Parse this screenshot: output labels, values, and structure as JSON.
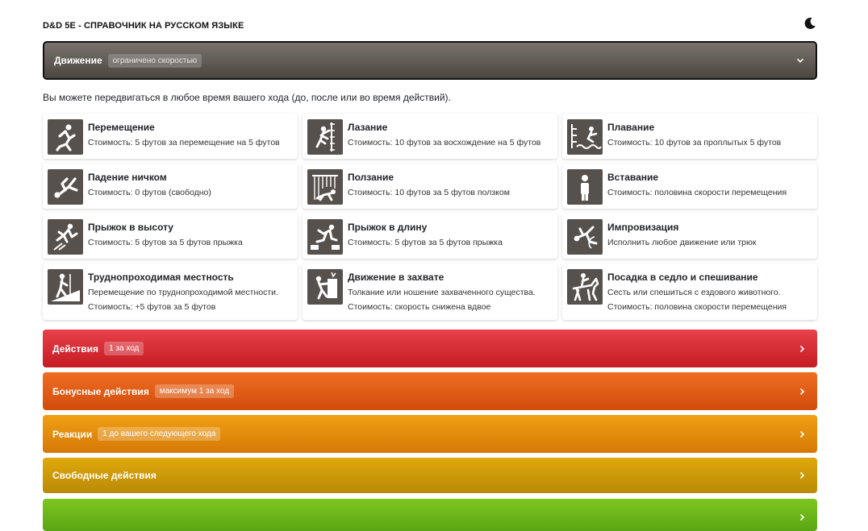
{
  "header": {
    "title": "D&D 5E - СПРАВОЧНИК НА РУССКОМ ЯЗЫКЕ",
    "theme_icon": "moon-icon"
  },
  "movement": {
    "title": "Движение",
    "badge": "ограничено скоростью",
    "intro": "Вы можете передвигаться в любое время вашего хода (до, после или во время действий).",
    "cards": [
      {
        "name": "Перемещение",
        "line1": "Стоимость: 5 футов за перемещение на 5 футов",
        "line2": "",
        "icon": "running-person-icon"
      },
      {
        "name": "Лазание",
        "line1": "Стоимость: 10 футов за восхождение на 5 футов",
        "line2": "",
        "icon": "climbing-icon"
      },
      {
        "name": "Плавание",
        "line1": "Стоимость: 10 футов за проплытых 5 футов",
        "line2": "",
        "icon": "diving-icon"
      },
      {
        "name": "Падение ничком",
        "line1": "Стоимость: 0 футов (свободно)",
        "line2": "",
        "icon": "falling-person-icon"
      },
      {
        "name": "Ползание",
        "line1": "Стоимость: 10 футов за 5 футов ползком",
        "line2": "",
        "icon": "crawling-icon"
      },
      {
        "name": "Вставание",
        "line1": "Стоимость: половина скорости перемещения",
        "line2": "",
        "icon": "standing-person-icon"
      },
      {
        "name": "Прыжок в высоту",
        "line1": "Стоимость: 5 футов за 5 футов прыжка",
        "line2": "",
        "icon": "high-jump-icon"
      },
      {
        "name": "Прыжок в длину",
        "line1": "Стоимость: 5 футов за 5 футов прыжка",
        "line2": "",
        "icon": "long-jump-icon"
      },
      {
        "name": "Импровизация",
        "line1": "Исполнить любое движение или трюк",
        "line2": "",
        "icon": "acrobatics-icon"
      },
      {
        "name": "Труднопроходимая местность",
        "line1": "Перемещение по труднопроходимой местности.",
        "line2": "Стоимость: +5 футов за 5 футов",
        "icon": "hiker-terrain-icon"
      },
      {
        "name": "Движение в захвате",
        "line1": "Толкание или ношение захваченного существа.",
        "line2": "Стоимость: скорость снижена вдвое",
        "icon": "pushing-icon"
      },
      {
        "name": "Посадка в седло и спешивание",
        "line1": "Сесть или спешиться с ездового животного.",
        "line2": "Стоимость: половина скорости перемещения",
        "icon": "horse-rider-icon"
      }
    ]
  },
  "sections": {
    "actions": {
      "title": "Действия",
      "badge": "1 за ход"
    },
    "bonus": {
      "title": "Бонусные действия",
      "badge": "максимум 1 за ход"
    },
    "reactions": {
      "title": "Реакции",
      "badge": "1 до вашего следующего хода"
    },
    "free": {
      "title": "Свободные действия"
    }
  },
  "colors": {
    "movement": "#5e5752",
    "actions": "#d62b33",
    "bonus": "#e55d17",
    "reactions": "#e38c0c",
    "free": "#cc9808",
    "next": "#6cb51a"
  }
}
